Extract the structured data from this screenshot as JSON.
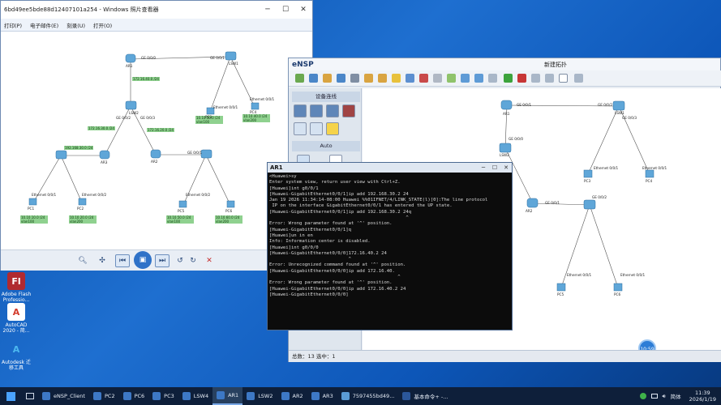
{
  "desktop": {
    "icons": [
      {
        "label": "Adobe Flash Professio...",
        "glyph": "Fl",
        "color": "#c0262d"
      },
      {
        "label": "AutoCAD 2020 - 简...",
        "glyph": "A",
        "color": "#d33b2b"
      },
      {
        "label": "Autodesk 迁移工具",
        "glyph": "A",
        "color": "#1f8fd0"
      }
    ]
  },
  "photo_viewer": {
    "title": "6bd49ee5bde88d12407101a254 - Windows 照片查看器",
    "menu": [
      "打印(P)",
      "电子邮件(E)",
      "刻录(U)",
      "打开(O)"
    ],
    "topology": {
      "ports": [
        "GE 0/0/0",
        "GE 0/0/1",
        "GE 0/0/2",
        "GE 0/0/3",
        "Ethernet 0/0/1",
        "Ethernet 0/0/2"
      ],
      "devices": [
        {
          "name": "AR1"
        },
        {
          "name": "LSW1"
        },
        {
          "name": "AR2"
        },
        {
          "name": "LSW2"
        },
        {
          "name": "AR3"
        },
        {
          "name": "PC1"
        },
        {
          "name": "PC2"
        },
        {
          "name": "PC3"
        },
        {
          "name": "PC4"
        },
        {
          "name": "PC5"
        },
        {
          "name": "PC6"
        }
      ],
      "labels": [
        "172.16.40.0 /24",
        "172.16.30.0 /24",
        "172.16.20.0 /24",
        "192.168.30.0 /24",
        "10.10.10.0 /24 vlan100",
        "10.10.20.0 /24 vlan200",
        "10.10.30.0 /24 vlan100",
        "10.10.40.0 /24 vlan200",
        "10.10.50.0 /24 vlan100",
        "10.10.60.0 /24 vlan200"
      ]
    },
    "controls": [
      "zoom-icon",
      "fit-icon",
      "prev-icon",
      "slideshow-icon",
      "next-icon",
      "rotate-left-icon",
      "rotate-right-icon",
      "delete-icon"
    ]
  },
  "ensp": {
    "logo": "eNSP",
    "title": "新建拓扑",
    "panel_title": "设备连线",
    "auto_label": "Auto",
    "status": "总数：13  选中：1",
    "badge": "10:59",
    "devices": [
      "AR1",
      "AR2",
      "AR3",
      "LSW1",
      "LSW2",
      "PC1",
      "PC2",
      "PC3",
      "PC4",
      "PC5",
      "PC6"
    ],
    "port_labels": [
      "GE 0/0/1",
      "GE 0/0/2",
      "GE 0/0/3",
      "GE 0/0/0",
      "Ethernet 0/0/1"
    ]
  },
  "terminal": {
    "title": "AR1",
    "lines": [
      "<Huawei>sy",
      "Enter system view, return user view with Ctrl+Z.",
      "[Huawei]int g0/0/1",
      "[Huawei-GigabitEthernet0/0/1]ip add 192.168.30.2 24",
      "Jan 19 2026 11:34:14-08:00 Huawei %%01IFNET/4/LINK_STATE(l)[0]:The line protocol",
      " IP on the interface GigabitEthernet0/0/1 has entered the UP state.",
      "[Huawei-GigabitEthernet0/0/1]ip add 192.168.30.2 24q",
      "                                                  ^",
      "Error: Wrong parameter found at '^' position.",
      "[Huawei-GigabitEthernet0/0/1]q",
      "[Huawei]un in en",
      "Info: Information center is disabled.",
      "[Huawei]int g0/0/0",
      "[Huawei-GigabitEthernet0/0/0]172.16.40.2 24",
      "                             ^",
      "Error: Unrecognized command found at '^' position.",
      "[Huawei-GigabitEthernet0/0/0]ip add 172.16.40.",
      "                                               ^",
      "Error: Wrong parameter found at '^' position.",
      "[Huawei-GigabitEthernet0/0/0]ip add 172.16.40.2 24",
      "[Huawei-GigabitEthernet0/0/0]"
    ]
  },
  "taskbar": {
    "items": [
      "eNSP_Client",
      "PC2",
      "PC6",
      "PC3",
      "LSW4",
      "AR1",
      "LSW2",
      "AR2",
      "AR3",
      "7597455bd49...",
      "基本命令+ -..."
    ],
    "active_index": 5,
    "ime": "简体",
    "time": "11:39",
    "date": "2026/1/19"
  }
}
